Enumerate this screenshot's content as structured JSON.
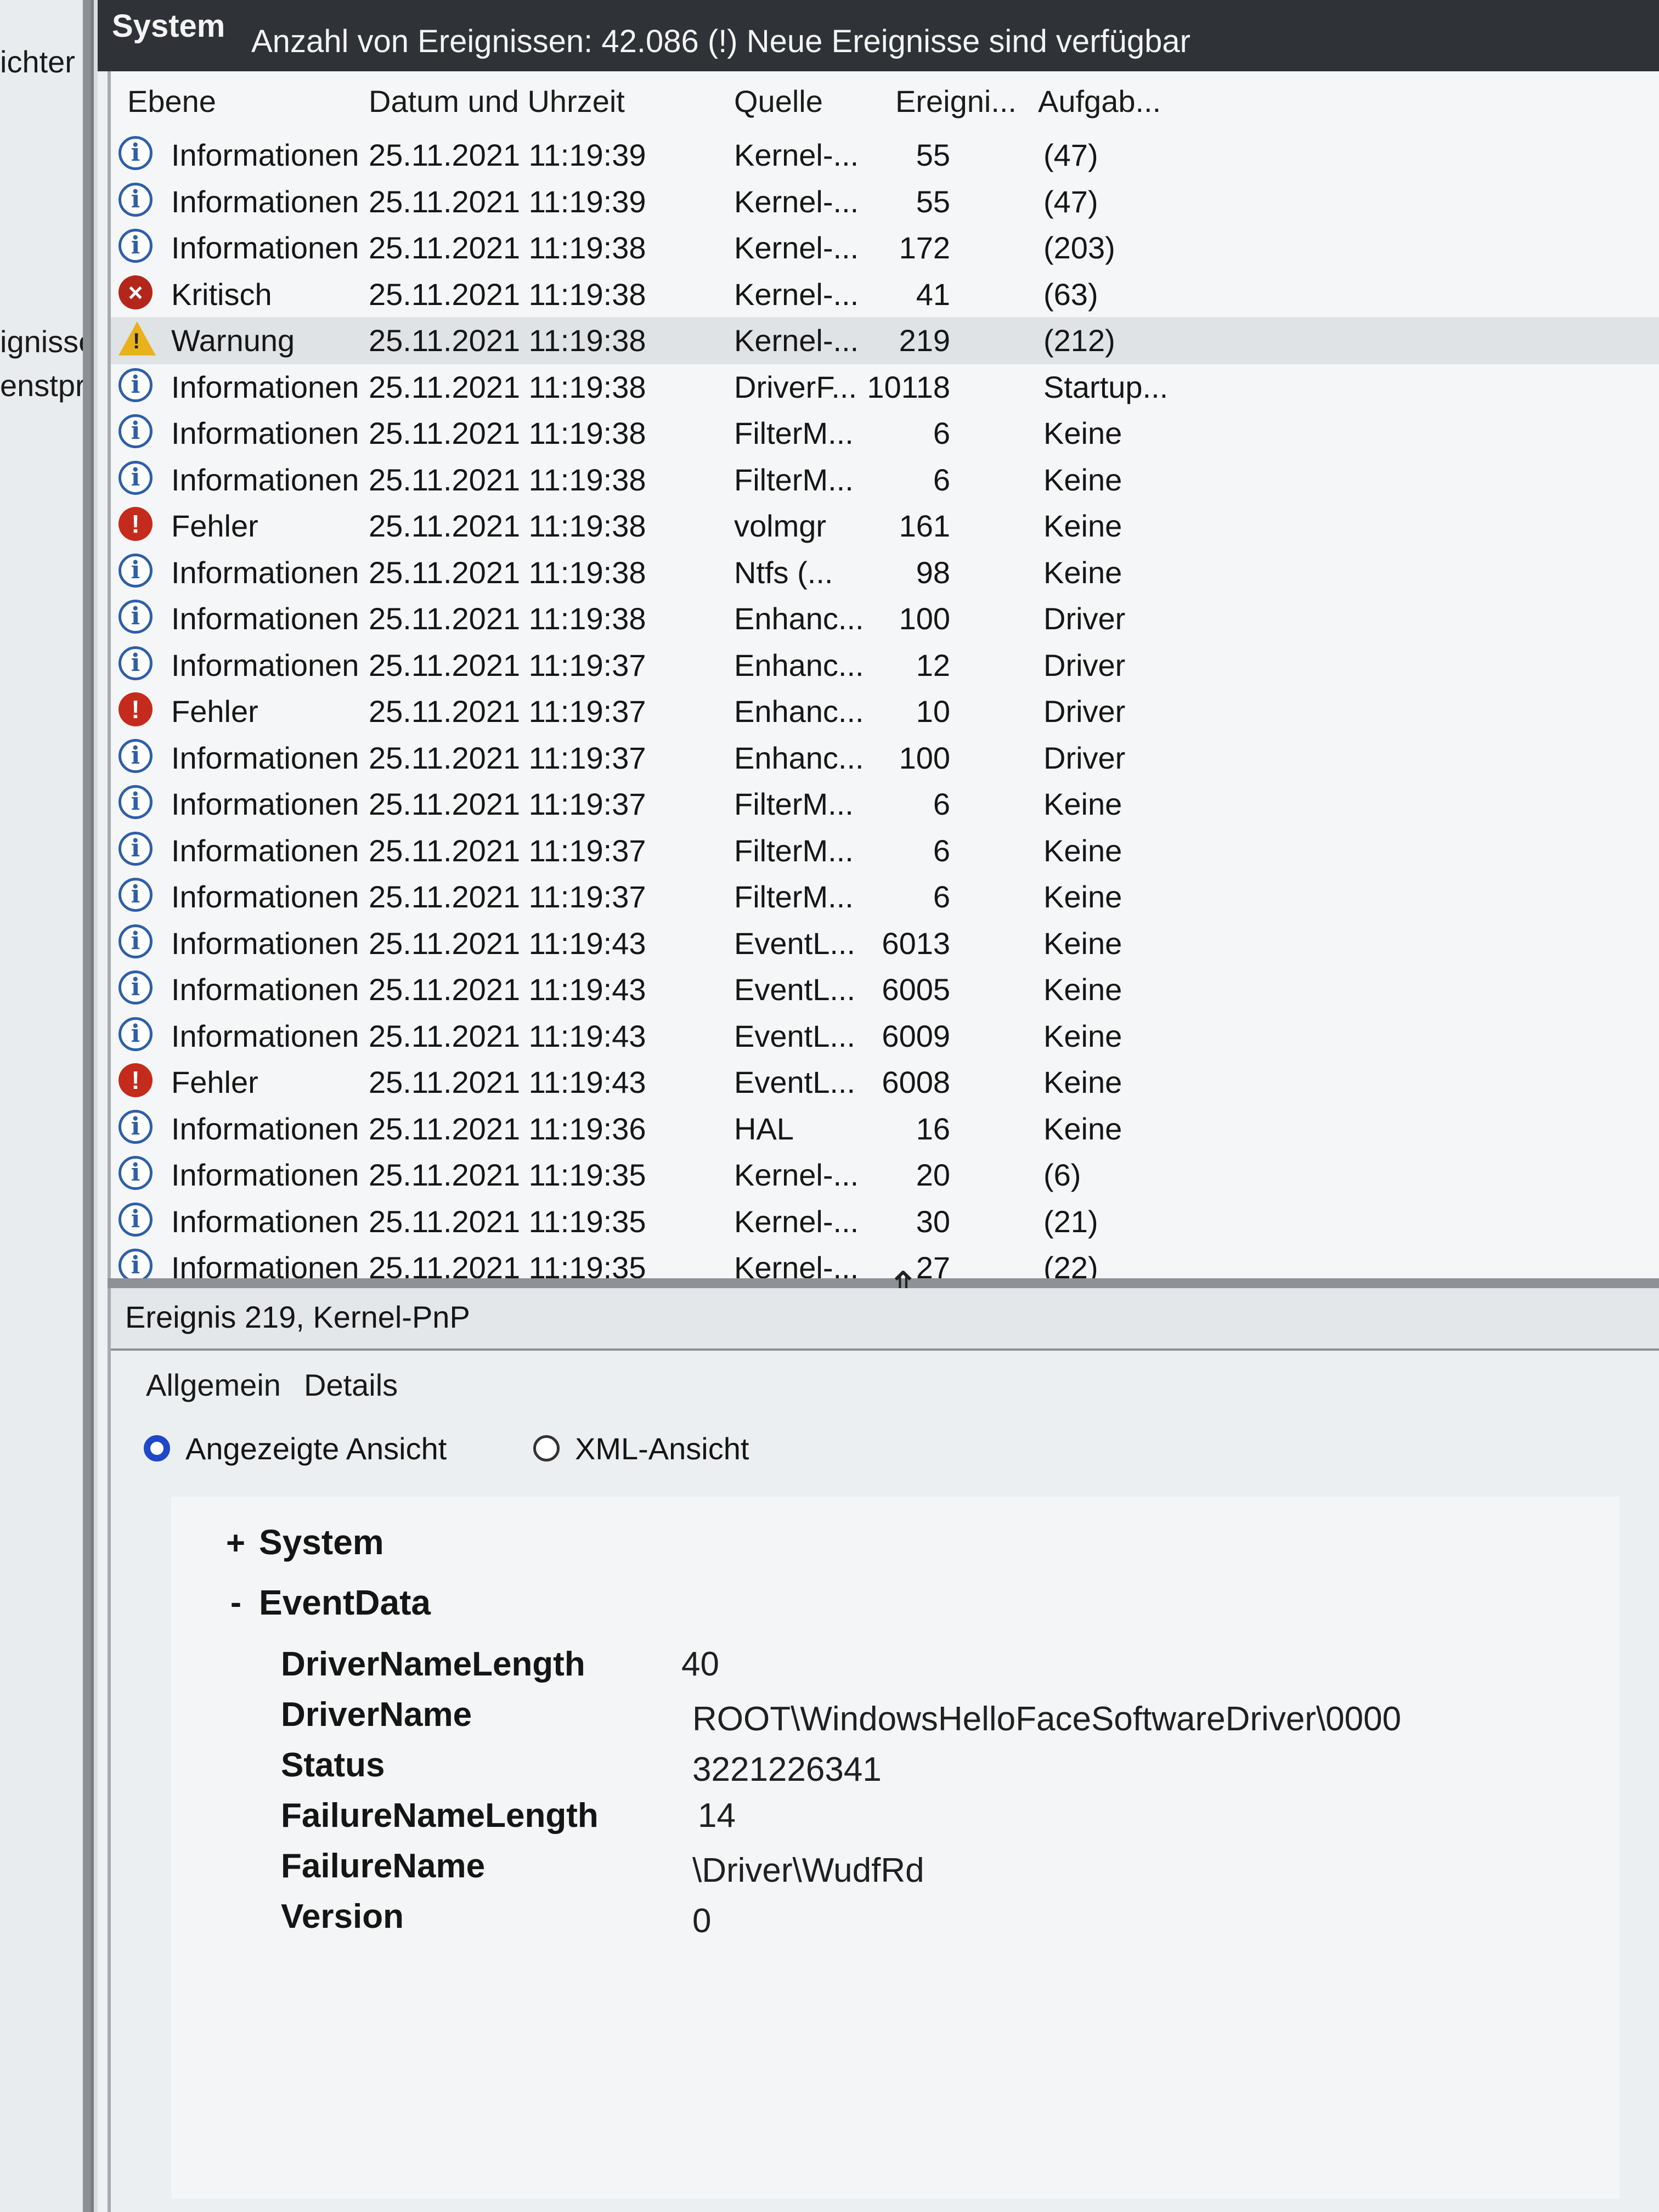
{
  "left_nav": {
    "items": [
      "ichter",
      "ignisse",
      "enstpro"
    ]
  },
  "header": {
    "title": "System",
    "count_text": "Anzahl von Ereignissen: 42.086 (!) Neue Ereignisse sind verfügbar"
  },
  "columns": {
    "level": "Ebene",
    "datetime": "Datum und Uhrzeit",
    "source": "Quelle",
    "event_id": "Ereigni...",
    "task": "Aufgab..."
  },
  "rows": [
    {
      "icon": "info-icon",
      "level": "Informationen",
      "datetime": "25.11.2021 11:19:39",
      "source": "Kernel-...",
      "event_id": "55",
      "task": "(47)"
    },
    {
      "icon": "info-icon",
      "level": "Informationen",
      "datetime": "25.11.2021 11:19:39",
      "source": "Kernel-...",
      "event_id": "55",
      "task": "(47)"
    },
    {
      "icon": "info-icon",
      "level": "Informationen",
      "datetime": "25.11.2021 11:19:38",
      "source": "Kernel-...",
      "event_id": "172",
      "task": "(203)"
    },
    {
      "icon": "critical-icon",
      "level": "Kritisch",
      "datetime": "25.11.2021 11:19:38",
      "source": "Kernel-...",
      "event_id": "41",
      "task": "(63)"
    },
    {
      "icon": "warning-icon",
      "level": "Warnung",
      "datetime": "25.11.2021 11:19:38",
      "source": "Kernel-...",
      "event_id": "219",
      "task": "(212)",
      "selected": true
    },
    {
      "icon": "info-icon",
      "level": "Informationen",
      "datetime": "25.11.2021 11:19:38",
      "source": "DriverF...",
      "event_id": "10118",
      "task": "Startup..."
    },
    {
      "icon": "info-icon",
      "level": "Informationen",
      "datetime": "25.11.2021 11:19:38",
      "source": "FilterM...",
      "event_id": "6",
      "task": "Keine"
    },
    {
      "icon": "info-icon",
      "level": "Informationen",
      "datetime": "25.11.2021 11:19:38",
      "source": "FilterM...",
      "event_id": "6",
      "task": "Keine"
    },
    {
      "icon": "error-icon",
      "level": "Fehler",
      "datetime": "25.11.2021 11:19:38",
      "source": "volmgr",
      "event_id": "161",
      "task": "Keine"
    },
    {
      "icon": "info-icon",
      "level": "Informationen",
      "datetime": "25.11.2021 11:19:38",
      "source": "Ntfs (...",
      "event_id": "98",
      "task": "Keine"
    },
    {
      "icon": "info-icon",
      "level": "Informationen",
      "datetime": "25.11.2021 11:19:38",
      "source": "Enhanc...",
      "event_id": "100",
      "task": "Driver"
    },
    {
      "icon": "info-icon",
      "level": "Informationen",
      "datetime": "25.11.2021 11:19:37",
      "source": "Enhanc...",
      "event_id": "12",
      "task": "Driver"
    },
    {
      "icon": "error-icon",
      "level": "Fehler",
      "datetime": "25.11.2021 11:19:37",
      "source": "Enhanc...",
      "event_id": "10",
      "task": "Driver"
    },
    {
      "icon": "info-icon",
      "level": "Informationen",
      "datetime": "25.11.2021 11:19:37",
      "source": "Enhanc...",
      "event_id": "100",
      "task": "Driver"
    },
    {
      "icon": "info-icon",
      "level": "Informationen",
      "datetime": "25.11.2021 11:19:37",
      "source": "FilterM...",
      "event_id": "6",
      "task": "Keine"
    },
    {
      "icon": "info-icon",
      "level": "Informationen",
      "datetime": "25.11.2021 11:19:37",
      "source": "FilterM...",
      "event_id": "6",
      "task": "Keine"
    },
    {
      "icon": "info-icon",
      "level": "Informationen",
      "datetime": "25.11.2021 11:19:37",
      "source": "FilterM...",
      "event_id": "6",
      "task": "Keine"
    },
    {
      "icon": "info-icon",
      "level": "Informationen",
      "datetime": "25.11.2021 11:19:43",
      "source": "EventL...",
      "event_id": "6013",
      "task": "Keine"
    },
    {
      "icon": "info-icon",
      "level": "Informationen",
      "datetime": "25.11.2021 11:19:43",
      "source": "EventL...",
      "event_id": "6005",
      "task": "Keine"
    },
    {
      "icon": "info-icon",
      "level": "Informationen",
      "datetime": "25.11.2021 11:19:43",
      "source": "EventL...",
      "event_id": "6009",
      "task": "Keine"
    },
    {
      "icon": "error-icon",
      "level": "Fehler",
      "datetime": "25.11.2021 11:19:43",
      "source": "EventL...",
      "event_id": "6008",
      "task": "Keine"
    },
    {
      "icon": "info-icon",
      "level": "Informationen",
      "datetime": "25.11.2021 11:19:36",
      "source": "HAL",
      "event_id": "16",
      "task": "Keine"
    },
    {
      "icon": "info-icon",
      "level": "Informationen",
      "datetime": "25.11.2021 11:19:35",
      "source": "Kernel-...",
      "event_id": "20",
      "task": "(6)"
    },
    {
      "icon": "info-icon",
      "level": "Informationen",
      "datetime": "25.11.2021 11:19:35",
      "source": "Kernel-...",
      "event_id": "30",
      "task": "(21)"
    },
    {
      "icon": "info-icon",
      "level": "Informationen",
      "datetime": "25.11.2021 11:19:35",
      "source": "Kernel-...",
      "event_id": "27",
      "task": "(22)"
    }
  ],
  "details": {
    "title": "Ereignis 219, Kernel-PnP",
    "tabs": [
      "Allgemein",
      "Details"
    ],
    "radio_friendly": "Angezeigte Ansicht",
    "radio_xml": "XML-Ansicht",
    "tree_system": "System",
    "tree_system_toggle": "+",
    "tree_eventdata": "EventData",
    "tree_eventdata_toggle": "-",
    "fields": [
      {
        "key": "DriverNameLength",
        "value": "40"
      },
      {
        "key": "DriverName",
        "value": "ROOT\\WindowsHelloFaceSoftwareDriver\\0000"
      },
      {
        "key": "Status",
        "value": "3221226341"
      },
      {
        "key": "FailureNameLength",
        "value": "14"
      },
      {
        "key": "FailureName",
        "value": "\\Driver\\WudfRd"
      },
      {
        "key": "Version",
        "value": "0"
      }
    ]
  }
}
